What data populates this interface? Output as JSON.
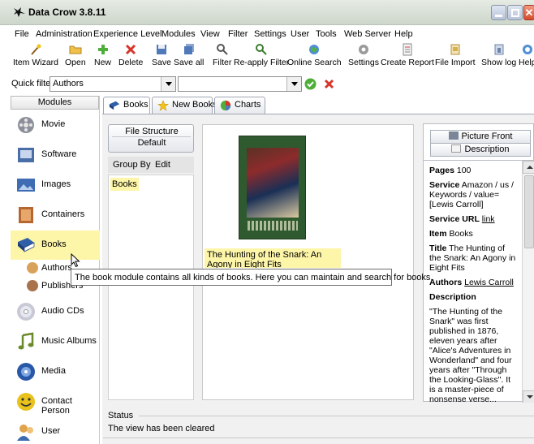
{
  "window": {
    "title": "Data Crow 3.8.11",
    "controls": [
      "minimize",
      "maximize",
      "close"
    ]
  },
  "menu": [
    "File",
    "Administration",
    "Experience Level",
    "Modules",
    "View",
    "Filter",
    "Settings",
    "User",
    "Tools",
    "Web Server",
    "Help"
  ],
  "toolbar": [
    {
      "label": "Item Wizard",
      "icon": "wand-icon"
    },
    {
      "label": "Open",
      "icon": "folder-icon"
    },
    {
      "label": "New",
      "icon": "plus-icon"
    },
    {
      "label": "Delete",
      "icon": "delete-x-icon"
    },
    {
      "label": "Save",
      "icon": "floppy-icon"
    },
    {
      "label": "Save all",
      "icon": "floppy-multi-icon"
    },
    {
      "label": "Filter",
      "icon": "magnifier-icon"
    },
    {
      "label": "Re-apply Filter",
      "icon": "magnifier-refresh-icon"
    },
    {
      "label": "Online Search",
      "icon": "globe-icon"
    },
    {
      "label": "Settings",
      "icon": "gear-icon"
    },
    {
      "label": "Create Report",
      "icon": "report-icon"
    },
    {
      "label": "File Import",
      "icon": "import-icon"
    },
    {
      "label": "Show log",
      "icon": "log-icon"
    },
    {
      "label": "Help",
      "icon": "help-icon"
    }
  ],
  "quickfilter": {
    "label": "Quick filter",
    "field_value": "Authors",
    "text_value": ""
  },
  "modules": {
    "header": "Modules",
    "items": [
      {
        "label": "Movie",
        "icon": "film-reel-icon",
        "color": "#8a8f99"
      },
      {
        "label": "Software",
        "icon": "software-box-icon",
        "color": "#4a6ea8"
      },
      {
        "label": "Images",
        "icon": "image-icon",
        "color": "#3f6db3"
      },
      {
        "label": "Containers",
        "icon": "container-box-icon",
        "color": "#b5672f"
      },
      {
        "label": "Books",
        "icon": "book-icon",
        "color": "#2e5fa8"
      },
      {
        "label": "Audio CDs",
        "icon": "cd-icon",
        "color": "#c9c9d6"
      },
      {
        "label": "Music Albums",
        "icon": "music-note-icon",
        "color": "#6b8a2a"
      },
      {
        "label": "Media",
        "icon": "media-disc-icon",
        "color": "#2a58a8"
      },
      {
        "label": "Contact Person",
        "icon": "smiley-icon",
        "color": "#e8c21d"
      },
      {
        "label": "User",
        "icon": "user-icon",
        "color": "#3d6bb0"
      }
    ],
    "subitems": [
      {
        "label": "Authors",
        "icon": "author-icon"
      },
      {
        "label": "Publishers",
        "icon": "publisher-icon"
      }
    ]
  },
  "tabs": [
    {
      "label": "Books",
      "icon": "book-icon"
    },
    {
      "label": "New Books",
      "icon": "star-icon"
    },
    {
      "label": "Charts",
      "icon": "chart-icon"
    }
  ],
  "grouping": {
    "file_structure": "File Structure",
    "default": "Default",
    "group_by": "Group By",
    "edit": "Edit",
    "tree_item": "Books"
  },
  "item": {
    "caption": "The Hunting of the Snark: An Agony in Eight Fits"
  },
  "tooltip": "The book module contains all kinds of books. Here you can maintain and search for books.",
  "details": {
    "picture_front": "Picture Front",
    "description_tab": "Description",
    "pages_label": "Pages",
    "pages_value": "100",
    "service_label": "Service",
    "service_value": "Amazon / us / Keywords / value=[Lewis Carroll]",
    "service_url_label": "Service URL",
    "service_url_value": "link",
    "item_label": "Item",
    "item_value": "Books",
    "title_label": "Title",
    "title_value": "The Hunting of the Snark: An Agony in Eight Fits",
    "authors_label": "Authors",
    "authors_value": "Lewis Carroll",
    "description_label": "Description",
    "description_value": "\"The Hunting of the Snark\" was first published in 1876, eleven years after \"Alice's Adventures in Wonderland\" and four years after \"Through the Looking-Glass\". It is a master-piece of nonsense verse..."
  },
  "status": {
    "label": "Status",
    "text": "The view has been cleared"
  }
}
